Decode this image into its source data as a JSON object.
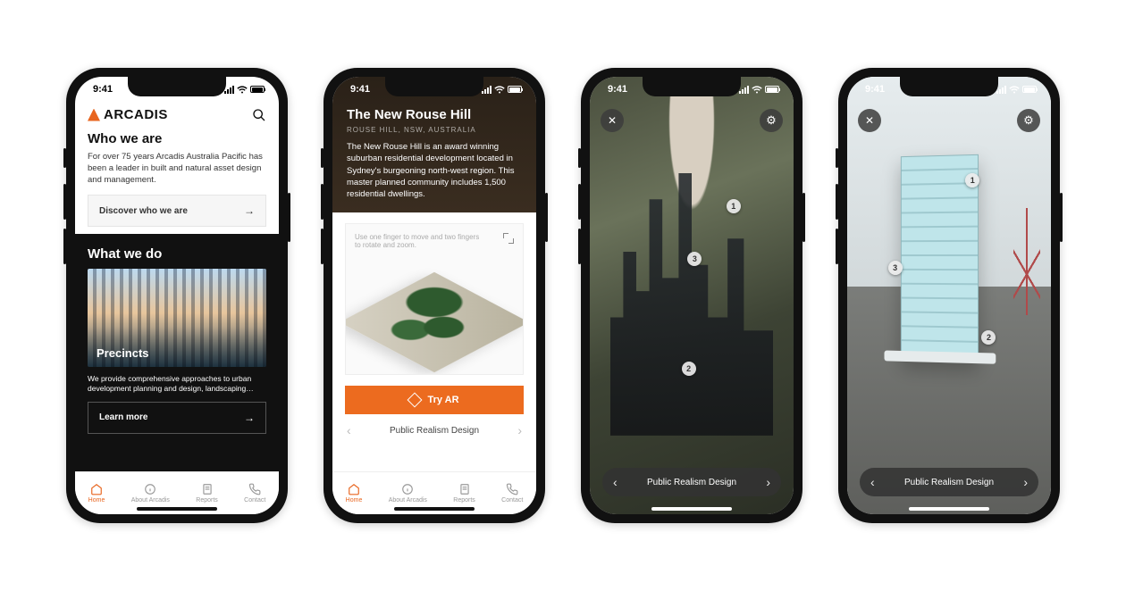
{
  "status_time": "9:41",
  "phone1": {
    "brand": "ARCADIS",
    "section1_title": "Who we are",
    "section1_desc": "For over 75 years Arcadis Australia Pacific has been a leader in built and natural asset design and management.",
    "discover_label": "Discover who we are",
    "section2_title": "What we do",
    "image_label": "Precincts",
    "section2_desc": "We provide comprehensive approaches to urban development planning and design, landscaping…",
    "learn_label": "Learn more"
  },
  "tabs": {
    "home": "Home",
    "about": "About Arcadis",
    "reports": "Reports",
    "contact": "Contact"
  },
  "phone2": {
    "title": "The New Rouse Hill",
    "location": "ROUSE HILL, NSW, AUSTRALIA",
    "desc": "The New Rouse Hill is an award winning suburban residential development located in Sydney's burgeoning north-west region. This master planned community includes 1,500 residential dwellings.",
    "hint": "Use one finger to move and two fingers to rotate and zoom.",
    "try_ar": "Try AR",
    "project_nav": "Public Realism Design"
  },
  "phone3": {
    "project_nav": "Public Realism Design",
    "markers": [
      "1",
      "2",
      "3"
    ]
  },
  "phone4": {
    "project_nav": "Public Realism Design",
    "markers": [
      "1",
      "2",
      "3"
    ]
  }
}
